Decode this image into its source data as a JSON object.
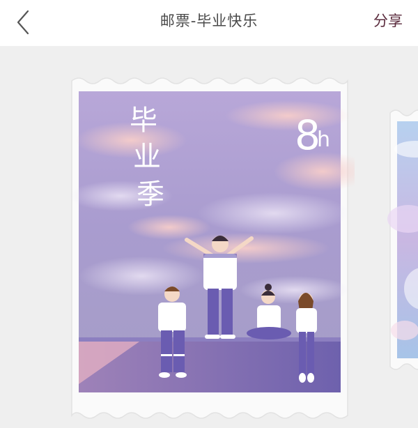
{
  "header": {
    "title": "邮票-毕业快乐",
    "share_label": "分享",
    "back_icon": "chevron-left-icon"
  },
  "stamp": {
    "title_chars": [
      "毕",
      "业",
      "季"
    ],
    "number": "8",
    "unit": "h",
    "colors": {
      "sky": "#a89bd0",
      "cloud": "#f0c6c9",
      "wall": "#7b6bb0",
      "uniform_pants": "#6a5cb1"
    }
  }
}
